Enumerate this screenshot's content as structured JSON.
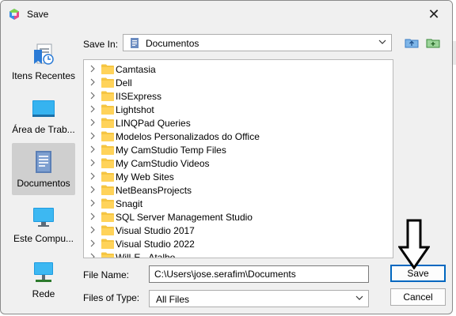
{
  "window": {
    "title": "Save",
    "app_icon": "hexagon-logo-icon",
    "close_icon": "close-icon"
  },
  "places": [
    {
      "label": "Itens Recentes",
      "icon": "recent-items-icon"
    },
    {
      "label": "Área de Trab...",
      "icon": "desktop-icon"
    },
    {
      "label": "Documentos",
      "icon": "documents-icon"
    },
    {
      "label": "Este Compu...",
      "icon": "computer-icon"
    },
    {
      "label": "Rede",
      "icon": "network-icon"
    }
  ],
  "save_in": {
    "label": "Save In:",
    "value": "Documentos"
  },
  "toolbar": {
    "up_icon": "up-folder-icon",
    "new_folder_icon": "new-folder-icon"
  },
  "files": [
    "Camtasia",
    "Dell",
    "IISExpress",
    "Lightshot",
    "LINQPad Queries",
    "Modelos Personalizados do Office",
    "My CamStudio Temp Files",
    "My CamStudio Videos",
    "My Web Sites",
    "NetBeansProjects",
    "Snagit",
    "SQL Server Management Studio",
    "Visual Studio 2017",
    "Visual Studio 2022",
    "Will-E - Atalho"
  ],
  "file_name": {
    "label": "File Name:",
    "value": "C:\\Users\\jose.serafim\\Documents"
  },
  "file_type": {
    "label": "Files of Type:",
    "value": "All Files"
  },
  "buttons": {
    "save": "Save",
    "cancel": "Cancel"
  },
  "colors": {
    "folder": "#f5c542",
    "accent": "#0067c0"
  }
}
